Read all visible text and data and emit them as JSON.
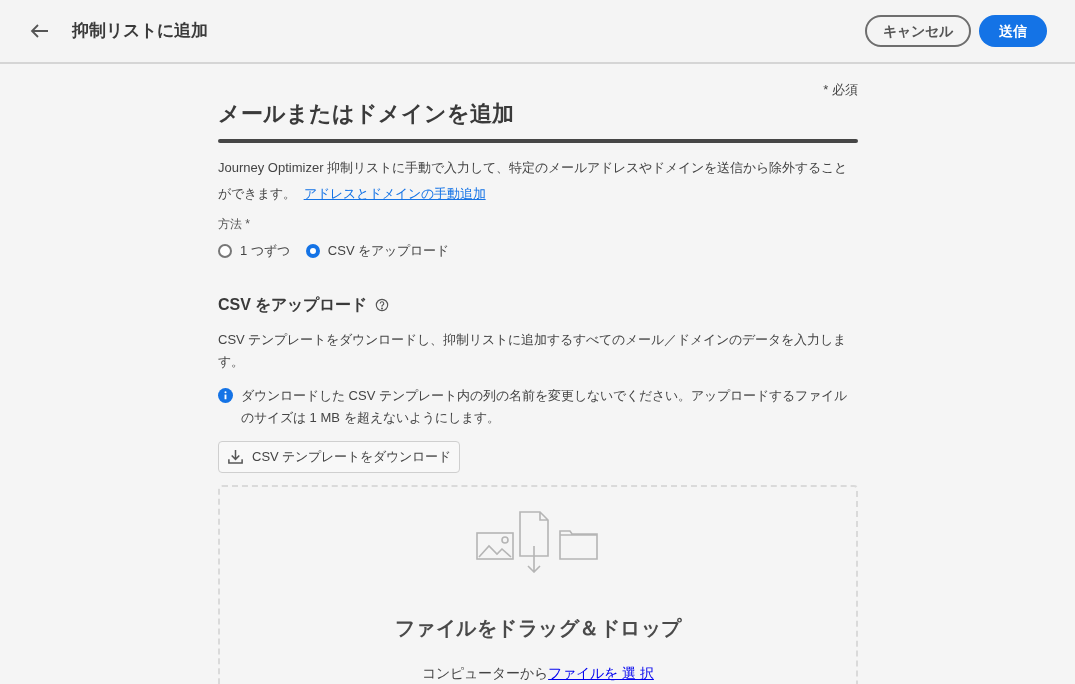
{
  "header": {
    "title": "抑制リストに追加",
    "cancel": "キャンセル",
    "submit": "送信"
  },
  "form": {
    "required_note": "* 必須",
    "title": "メールまたはドメインを追加",
    "intro": "Journey Optimizer 抑制リストに手動で入力して、特定のメールアドレスやドメインを送信から除外することができます。",
    "intro_link": "アドレスとドメインの手動追加",
    "method_label": "方法 *",
    "methods": [
      {
        "label": "1 つずつ",
        "selected": false
      },
      {
        "label": "CSV をアップロード",
        "selected": true
      }
    ]
  },
  "upload": {
    "title": "CSV をアップロード",
    "description": "CSV テンプレートをダウンロードし、抑制リストに追加するすべてのメール／ドメインのデータを入力します。",
    "info": "ダウンロードした CSV テンプレート内の列の名前を変更しないでください。アップロードするファイルのサイズは 1 MB を超えないようにします。",
    "download_button": "CSV テンプレートをダウンロード",
    "drop_title": "ファイルをドラッグ＆ドロップ",
    "drop_hint": "コンピューターから",
    "drop_link": "ファイルを 選 択"
  }
}
